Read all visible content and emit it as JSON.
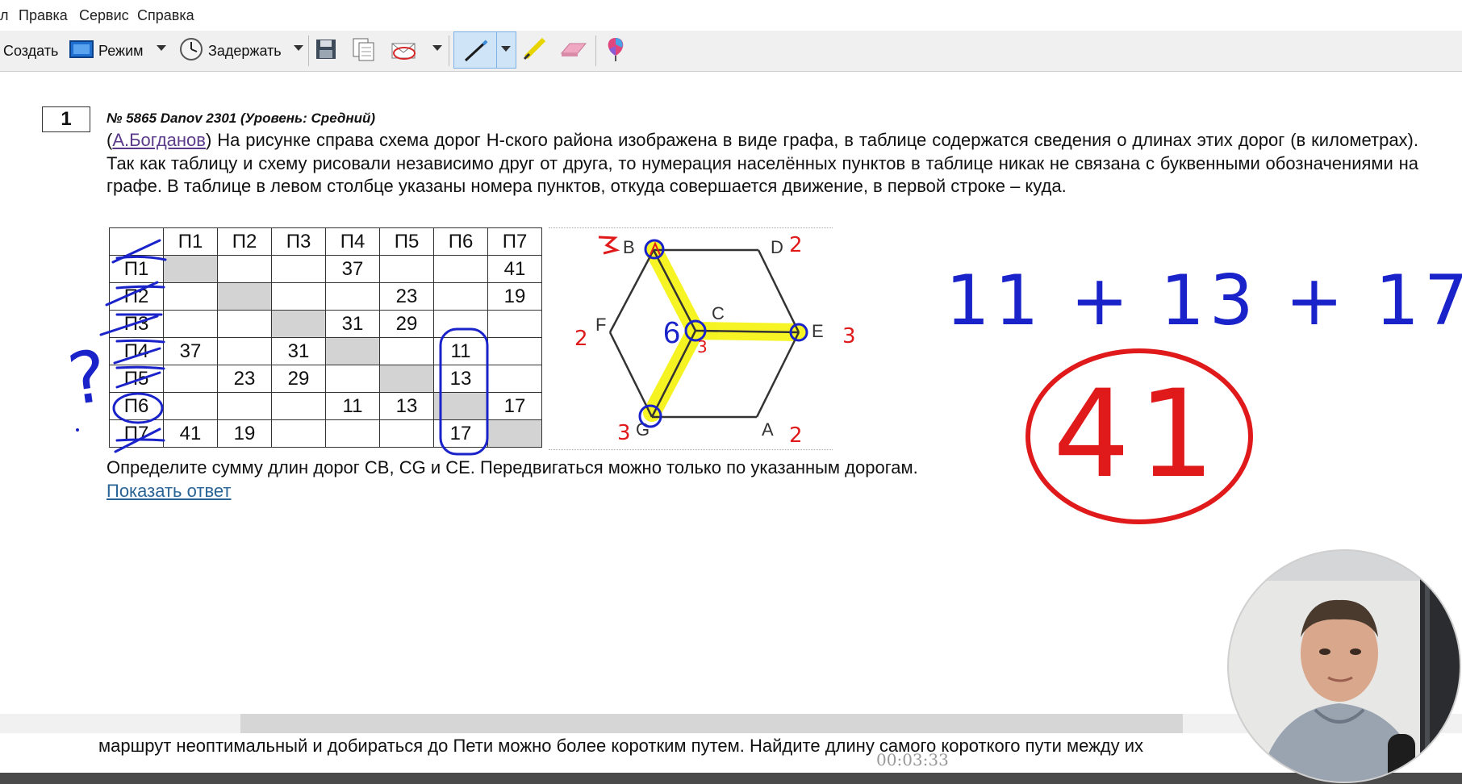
{
  "menu": {
    "items": [
      "л",
      "Правка",
      "Сервис",
      "Справка"
    ]
  },
  "toolbar": {
    "create_label": "Создать",
    "mode_label": "Режим",
    "delay_label": "Задержать"
  },
  "problem": {
    "number": "1",
    "meta": "№ 5865 Danov 2301 (Уровень: Средний)",
    "author": "А.Богданов",
    "text": ") На рисунке справа схема дорог Н-ского района изображена в виде графа, в таблице содержатся сведения о длинах этих дорог (в километрах). Так как таблицу и схему рисовали независимо друг от друга, то нумерация населённых пунктов в таблице никак не связана с буквенными обозначениями на графе. В таблице в левом столбце указаны номера пунктов, откуда совершается движение, в первой строке – куда.",
    "question": "Определите сумму длин дорог CB, CG и CE. Передвигаться можно только по указанным дорогам.",
    "show_answer": "Показать ответ"
  },
  "table": {
    "header": [
      "",
      "П1",
      "П2",
      "П3",
      "П4",
      "П5",
      "П6",
      "П7"
    ],
    "rows": [
      [
        "П1",
        "",
        "",
        "",
        "37",
        "",
        "",
        "41"
      ],
      [
        "П2",
        "",
        "",
        "",
        "",
        "23",
        "",
        "19"
      ],
      [
        "П3",
        "",
        "",
        "",
        "31",
        "29",
        "",
        ""
      ],
      [
        "П4",
        "37",
        "",
        "31",
        "",
        "",
        "11",
        ""
      ],
      [
        "П5",
        "",
        "23",
        "29",
        "",
        "",
        "13",
        ""
      ],
      [
        "П6",
        "",
        "",
        "",
        "11",
        "13",
        "",
        "17"
      ],
      [
        "П7",
        "41",
        "19",
        "",
        "",
        "",
        "17",
        ""
      ]
    ]
  },
  "graph": {
    "nodes": [
      "A",
      "B",
      "C",
      "D",
      "E",
      "F",
      "G"
    ]
  },
  "annotations": {
    "sum_expression": "11 + 13 + 17",
    "answer": "41",
    "question_mark": "?",
    "degrees": [
      "3",
      "2",
      "2",
      "6",
      "3",
      "3",
      "3",
      "2"
    ]
  },
  "player": {
    "subtitle": "маршрут неоптимальный и добираться до Пети можно более коротким путем. Найдите длину самого короткого пути между их",
    "timer": "00:03:33"
  },
  "colors": {
    "ink_red": "#e0191b",
    "ink_blue": "#1a23c9",
    "highlight": "#f6f318",
    "link": "#2a6496"
  }
}
